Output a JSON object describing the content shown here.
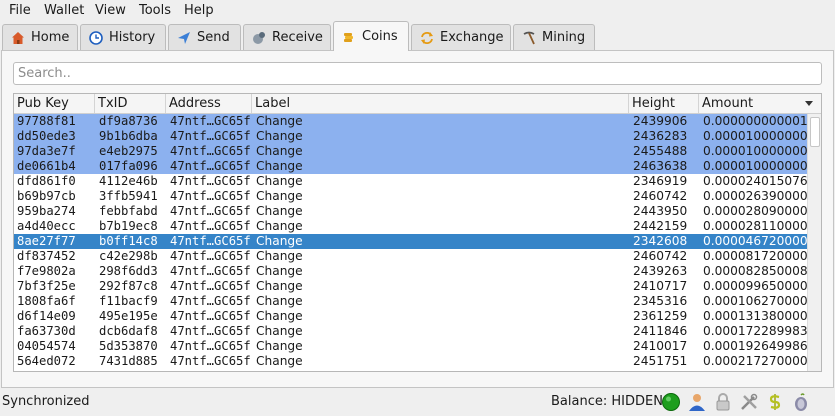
{
  "menu": [
    "File",
    "Wallet",
    "View",
    "Tools",
    "Help"
  ],
  "tabs": [
    {
      "label": "Home",
      "icon": "home-icon"
    },
    {
      "label": "History",
      "icon": "history-icon"
    },
    {
      "label": "Send",
      "icon": "send-icon"
    },
    {
      "label": "Receive",
      "icon": "receive-icon"
    },
    {
      "label": "Coins",
      "icon": "coins-icon",
      "active": true
    },
    {
      "label": "Exchange",
      "icon": "exchange-icon"
    },
    {
      "label": "Mining",
      "icon": "pickaxe-icon"
    }
  ],
  "search": {
    "placeholder": "Search.."
  },
  "table": {
    "columns": [
      "Pub Key",
      "TxID",
      "Address",
      "Label",
      "Height",
      "Amount"
    ],
    "sort_column": "Amount",
    "rows": [
      {
        "pubkey": "97788f81",
        "txid": "df9a8736",
        "address": "47ntf…GC65f",
        "label": "Change",
        "height": "2439906",
        "amount": "0.000000000001",
        "state": "selected"
      },
      {
        "pubkey": "dd50ede3",
        "txid": "9b1b6dba",
        "address": "47ntf…GC65f",
        "label": "Change",
        "height": "2436283",
        "amount": "0.000010000000",
        "state": "selected"
      },
      {
        "pubkey": "97da3e7f",
        "txid": "e4eb2975",
        "address": "47ntf…GC65f",
        "label": "Change",
        "height": "2455488",
        "amount": "0.000010000000",
        "state": "selected"
      },
      {
        "pubkey": "de0661b4",
        "txid": "017fa096",
        "address": "47ntf…GC65f",
        "label": "Change",
        "height": "2463638",
        "amount": "0.000010000000",
        "state": "selected"
      },
      {
        "pubkey": "dfd861f0",
        "txid": "4112e46b",
        "address": "47ntf…GC65f",
        "label": "Change",
        "height": "2346919",
        "amount": "0.000024015076",
        "state": ""
      },
      {
        "pubkey": "b69b97cb",
        "txid": "3ffb5941",
        "address": "47ntf…GC65f",
        "label": "Change",
        "height": "2460742",
        "amount": "0.000026390000",
        "state": ""
      },
      {
        "pubkey": "959ba274",
        "txid": "febbfabd",
        "address": "47ntf…GC65f",
        "label": "Change",
        "height": "2443950",
        "amount": "0.000028090000",
        "state": ""
      },
      {
        "pubkey": "a4d40ecc",
        "txid": "b7b19ec8",
        "address": "47ntf…GC65f",
        "label": "Change",
        "height": "2442159",
        "amount": "0.000028110000",
        "state": ""
      },
      {
        "pubkey": "8ae27f77",
        "txid": "b0ff14c8",
        "address": "47ntf…GC65f",
        "label": "Change",
        "height": "2342608",
        "amount": "0.000046720000",
        "state": "current"
      },
      {
        "pubkey": "df837452",
        "txid": "c42e298b",
        "address": "47ntf…GC65f",
        "label": "Change",
        "height": "2460742",
        "amount": "0.000081720000",
        "state": ""
      },
      {
        "pubkey": "f7e9802a",
        "txid": "298f6dd3",
        "address": "47ntf…GC65f",
        "label": "Change",
        "height": "2439263",
        "amount": "0.000082850008",
        "state": ""
      },
      {
        "pubkey": "7bf3f25e",
        "txid": "292f87c8",
        "address": "47ntf…GC65f",
        "label": "Change",
        "height": "2410717",
        "amount": "0.000099650000",
        "state": ""
      },
      {
        "pubkey": "1808fa6f",
        "txid": "f11bacf9",
        "address": "47ntf…GC65f",
        "label": "Change",
        "height": "2345316",
        "amount": "0.000106270000",
        "state": ""
      },
      {
        "pubkey": "d6f14e09",
        "txid": "495e195e",
        "address": "47ntf…GC65f",
        "label": "Change",
        "height": "2361259",
        "amount": "0.000131380000",
        "state": ""
      },
      {
        "pubkey": "fa63730d",
        "txid": "dcb6daf8",
        "address": "47ntf…GC65f",
        "label": "Change",
        "height": "2411846",
        "amount": "0.000172289983",
        "state": ""
      },
      {
        "pubkey": "04054574",
        "txid": "5d353870",
        "address": "47ntf…GC65f",
        "label": "Change",
        "height": "2410017",
        "amount": "0.000192649986",
        "state": ""
      },
      {
        "pubkey": "564ed072",
        "txid": "7431d885",
        "address": "47ntf…GC65f",
        "label": "Change",
        "height": "2451751",
        "amount": "0.000217270000",
        "state": ""
      }
    ]
  },
  "status": {
    "sync_text": "Synchronized",
    "balance_text": "Balance: HIDDEN",
    "icons": [
      "connection-status-icon",
      "contacts-icon",
      "lock-icon",
      "settings-icon",
      "seed-icon",
      "tor-icon"
    ]
  },
  "colors": {
    "selected_row": "#8cb1ef",
    "current_row": "#3584c8",
    "connected": "#1e9e1e"
  }
}
